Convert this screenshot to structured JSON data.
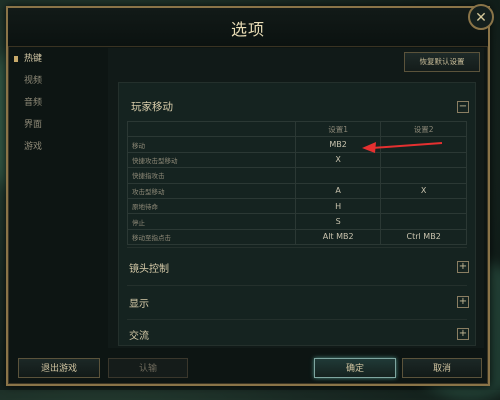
{
  "window": {
    "title": "选项",
    "close_glyph": "✕"
  },
  "sidebar": {
    "items": [
      {
        "label": "热键",
        "active": true
      },
      {
        "label": "视频",
        "active": false
      },
      {
        "label": "音频",
        "active": false
      },
      {
        "label": "界面",
        "active": false
      },
      {
        "label": "游戏",
        "active": false
      }
    ]
  },
  "content": {
    "reset_label": "恢复默认设置",
    "section": {
      "title": "玩家移动",
      "toggle": "−",
      "col1": "设置1",
      "col2": "设置2",
      "rows": [
        {
          "action": "移动",
          "k1": "MB2",
          "k2": ""
        },
        {
          "action": "快捷攻击型移动",
          "k1": "X",
          "k2": ""
        },
        {
          "action": "快捷指攻击",
          "k1": "",
          "k2": ""
        },
        {
          "action": "攻击型移动",
          "k1": "A",
          "k2": "X"
        },
        {
          "action": "原地待命",
          "k1": "H",
          "k2": ""
        },
        {
          "action": "停止",
          "k1": "S",
          "k2": ""
        },
        {
          "action": "移动至指点击",
          "k1": "Alt  MB2",
          "k2": "Ctrl  MB2"
        }
      ]
    },
    "collapsed_sections": [
      {
        "title": "镜头控制",
        "toggle": "+"
      },
      {
        "title": "显示",
        "toggle": "+"
      },
      {
        "title": "交流",
        "toggle": "+"
      }
    ]
  },
  "footer": {
    "exit_label": "退出游戏",
    "surrender_label": "认输",
    "ok_label": "确定",
    "cancel_label": "取消"
  },
  "colors": {
    "gold_border": "#8a7448",
    "arrow": "#e53030"
  }
}
